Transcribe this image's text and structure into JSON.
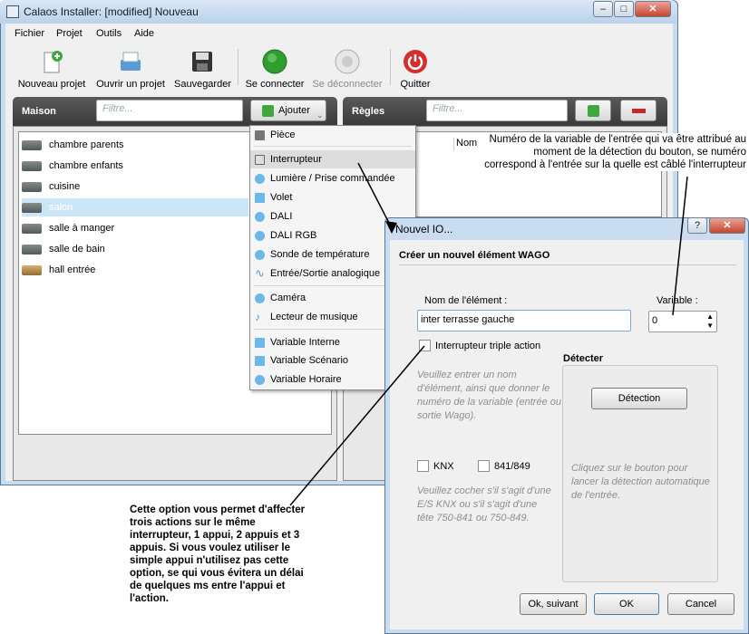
{
  "window": {
    "title": "Calaos Installer: [modified] Nouveau",
    "min": "–",
    "max": "□",
    "close": "✕"
  },
  "menu": [
    "Fichier",
    "Projet",
    "Outils",
    "Aide"
  ],
  "toolbar": {
    "new": "Nouveau projet",
    "open": "Ouvrir un projet",
    "save": "Sauvegarder",
    "connect": "Se connecter",
    "disconnect": "Se déconnecter",
    "quit": "Quitter"
  },
  "maison": {
    "title": "Maison",
    "filter": "Filtre...",
    "add_label": "Ajouter",
    "rooms": [
      "chambre parents",
      "chambre enfants",
      "cuisine",
      "salon",
      "salle à manger",
      "salle de bain",
      "hall entrée"
    ]
  },
  "regles": {
    "title": "Règles",
    "filter": "Filtre...",
    "col": "Nom"
  },
  "dropdown": [
    "Pièce",
    "Interrupteur",
    "Lumière / Prise commandée",
    "Volet",
    "DALI",
    "DALI RGB",
    "Sonde de température",
    "Entrée/Sortie analogique",
    "Caméra",
    "Lecteur de musique",
    "Variable Interne",
    "Variable Scénario",
    "Variable Horaire"
  ],
  "dialog": {
    "title": "Nouvel IO...",
    "help": "?",
    "close": "✕",
    "heading": "Créer un nouvel élément WAGO",
    "name_label": "Nom de l'élément :",
    "name_value": "inter terrasse gauche",
    "var_label": "Variable :",
    "var_value": "0",
    "triple_label": "Interrupteur triple action",
    "hint1": "Veuillez entrer un nom d'élément, ainsi que donner le numéro de la variable (entrée ou sortie Wago).",
    "detect_title": "Détecter",
    "detect_btn": "Détection",
    "detect_hint": "Cliquez sur le bouton pour lancer la détection automatique de l'entrée.",
    "knx": "KNX",
    "t841": "841/849",
    "hint2": "Veuillez cocher s'il s'agit d'une E/S KNX ou s'il s'agit d'une tête 750-841 ou 750-849.",
    "ok_next": "Ok, suivant",
    "ok": "OK",
    "cancel": "Cancel"
  },
  "notes": {
    "top": "Numéro de la variable de l'entrée qui va être attribué au moment de la détection du bouton, se numéro correspond à l'entrée sur la quelle est câblé l'interrupteur",
    "bottom": "Cette option vous permet d'affecter trois actions sur le même interrupteur, 1 appui, 2 appuis et 3 appuis. Si vous voulez utiliser le simple appui n'utilisez pas cette option, se qui vous évitera un délai de quelques ms entre l'appui et l'action."
  },
  "colors": {
    "accent": "#2f8f2f",
    "danger": "#c62828",
    "selection": "#cde6f7"
  }
}
